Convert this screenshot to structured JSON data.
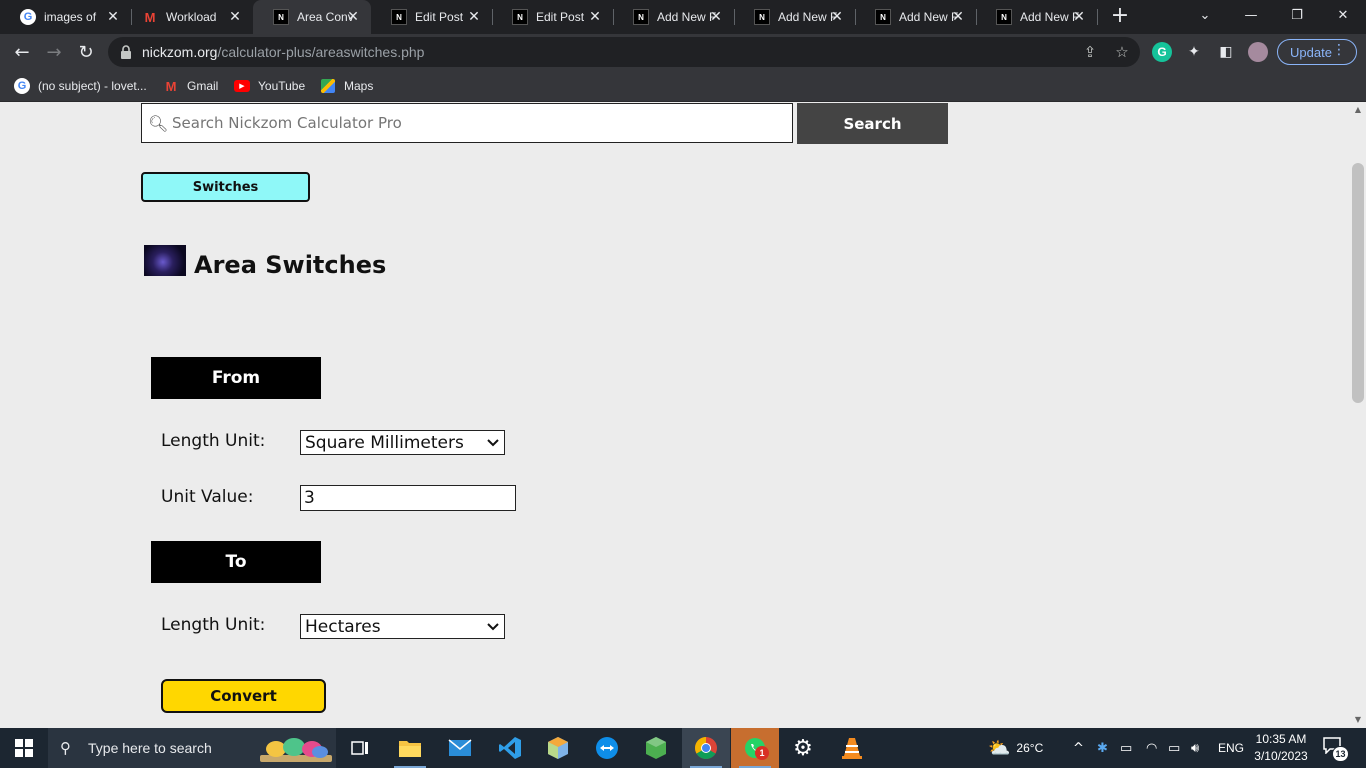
{
  "browser": {
    "tabs": [
      {
        "title": "images of",
        "favicon": "google-icon",
        "active": false
      },
      {
        "title": "Workload",
        "favicon": "gmail-icon",
        "active": false
      },
      {
        "title": "Area Conv",
        "favicon": "nickzom-icon",
        "active": true
      },
      {
        "title": "Edit Post",
        "favicon": "nickzom-icon",
        "active": false
      },
      {
        "title": "Edit Post",
        "favicon": "nickzom-icon",
        "active": false
      },
      {
        "title": "Add New F",
        "favicon": "nickzom-icon",
        "active": false
      },
      {
        "title": "Add New F",
        "favicon": "nickzom-icon",
        "active": false
      },
      {
        "title": "Add New F",
        "favicon": "nickzom-icon",
        "active": false
      },
      {
        "title": "Add New F",
        "favicon": "nickzom-icon",
        "active": false
      }
    ],
    "url_host": "nickzom.org",
    "url_path": "/calculator-plus/areaswitches.php",
    "update_label": "Update",
    "bookmarks": [
      {
        "label": "(no subject) - lovet...",
        "icon": "google-icon"
      },
      {
        "label": "Gmail",
        "icon": "gmail-icon"
      },
      {
        "label": "YouTube",
        "icon": "youtube-icon"
      },
      {
        "label": "Maps",
        "icon": "maps-icon"
      }
    ]
  },
  "page": {
    "search": {
      "placeholder": "Search Nickzom Calculator Pro",
      "button_label": "Search"
    },
    "switches_label": "Switches",
    "title": "Area Switches",
    "from": {
      "heading": "From",
      "unit_label": "Length Unit:",
      "unit_value": "Square Millimeters",
      "value_label": "Unit Value:",
      "value": "3"
    },
    "to": {
      "heading": "To",
      "unit_label": "Length Unit:",
      "unit_value": "Hectares"
    },
    "convert_label": "Convert"
  },
  "taskbar": {
    "search_placeholder": "Type here to search",
    "apps": [
      "holi-colors-icon",
      "task-view-icon",
      "file-explorer-icon",
      "mail-icon",
      "vscode-icon",
      "virtualbox-icon",
      "teamviewer-icon",
      "cube-app-icon",
      "chrome-icon",
      "whatsapp-icon",
      "settings-icon",
      "vlc-icon"
    ],
    "whatsapp_badge": "1",
    "weather": "26°C",
    "language": "ENG",
    "time": "10:35 AM",
    "date": "3/10/2023",
    "notification_count": "13"
  },
  "colors": {
    "switches_button": "#8ff8f8",
    "convert_button": "#ffd700",
    "section_heading": "#000000",
    "search_button": "#444444"
  }
}
